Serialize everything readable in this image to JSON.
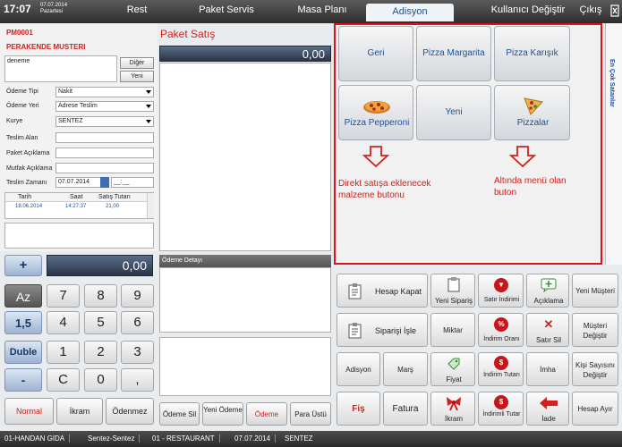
{
  "topbar": {
    "time": "17:07",
    "date": "07.07.2014",
    "day": "Pazartesi",
    "tabs": [
      "Rest",
      "Paket Servis",
      "Masa Planı",
      "Adisyon"
    ],
    "active_tab": "Adisyon",
    "user_switch": "Kullanıcı Değiştir",
    "exit": "Çıkış"
  },
  "customer": {
    "code": "PM0001",
    "name": "PERAKENDE MUSTERI",
    "address": "deneme",
    "other_btn": "Diğer",
    "new_btn": "Yeni"
  },
  "form": {
    "payment_type_label": "Ödeme Tipi",
    "payment_type_value": "Nakit",
    "payment_place_label": "Ödeme Yeri",
    "payment_place_value": "Adrese Teslim",
    "courier_label": "Kurye",
    "courier_value": "SENTEZ",
    "receiver_label": "Teslim Alan",
    "package_note_label": "Paket Açıklama",
    "kitchen_note_label": "Mutfak Açıklama",
    "delivery_time_label": "Teslim Zamanı",
    "delivery_date": "07.07.2014",
    "delivery_time": "__:__"
  },
  "history": {
    "headers": [
      "Tarih",
      "Saat",
      "Satış Tutarı"
    ],
    "rows": [
      [
        "18.06.2014",
        "14:27:37",
        "21,00"
      ]
    ]
  },
  "numpad": {
    "display": "0,00",
    "plus": "+",
    "minus": "-",
    "az": "Az",
    "onefive": "1,5",
    "double": "Duble",
    "clear": "C",
    "keys": [
      "7",
      "8",
      "9",
      "4",
      "5",
      "6",
      "1",
      "2",
      "3",
      "0",
      ","
    ],
    "normal": "Normal",
    "ikram": "İkram",
    "odenmez": "Ödenmez"
  },
  "sale": {
    "title": "Paket Satış",
    "total": "0,00",
    "payment_detail": "Ödeme Detayı",
    "btn_delete_payment": "Ödeme Sil",
    "btn_new_payment": "Yeni Ödeme",
    "btn_payment": "Ödeme",
    "btn_change": "Para Üstü"
  },
  "menu": {
    "items": [
      "Geri",
      "Pizza Margarita",
      "Pizza Karışık",
      "Pizza Pepperoni",
      "Yeni",
      "Pizzalar"
    ],
    "annotation_left": "Direkt satışa eklenecek malzeme butonu",
    "annotation_right": "Altında menü olan buton",
    "sidebar": "En Çok Satanlar"
  },
  "actions": {
    "hesap_kapat": "Hesap Kapat",
    "yeni_siparis": "Yeni Sipariş",
    "satir_indirimi": "Satır İndirimi",
    "aciklama": "Açıklama",
    "yeni_musteri": "Yeni Müşteri",
    "siparisi_isle": "Siparişi İşle",
    "miktar": "Miktar",
    "indirim_orani": "İndirim Oranı",
    "satir_sil": "Satır Sil",
    "musteri_degistir": "Müşteri Değiştir",
    "adisyon": "Adisyon",
    "mars": "Marş",
    "fiyat": "Fiyat",
    "indirim_tutari": "İndirim Tutarı",
    "imha": "İmha",
    "kisi_sayisini": "Kişi Sayısını Değiştir",
    "fis": "Fiş",
    "fatura": "Fatura",
    "ikram": "İkram",
    "indirimli_tutar": "İndirimli Tutar",
    "iade": "İade",
    "hesap_ayir": "Hesap Ayır"
  },
  "status": [
    "01-HANDAN GIDA",
    "Sentez-Sentez",
    "01 - RESTAURANT",
    "07.07.2014",
    "SENTEZ"
  ]
}
